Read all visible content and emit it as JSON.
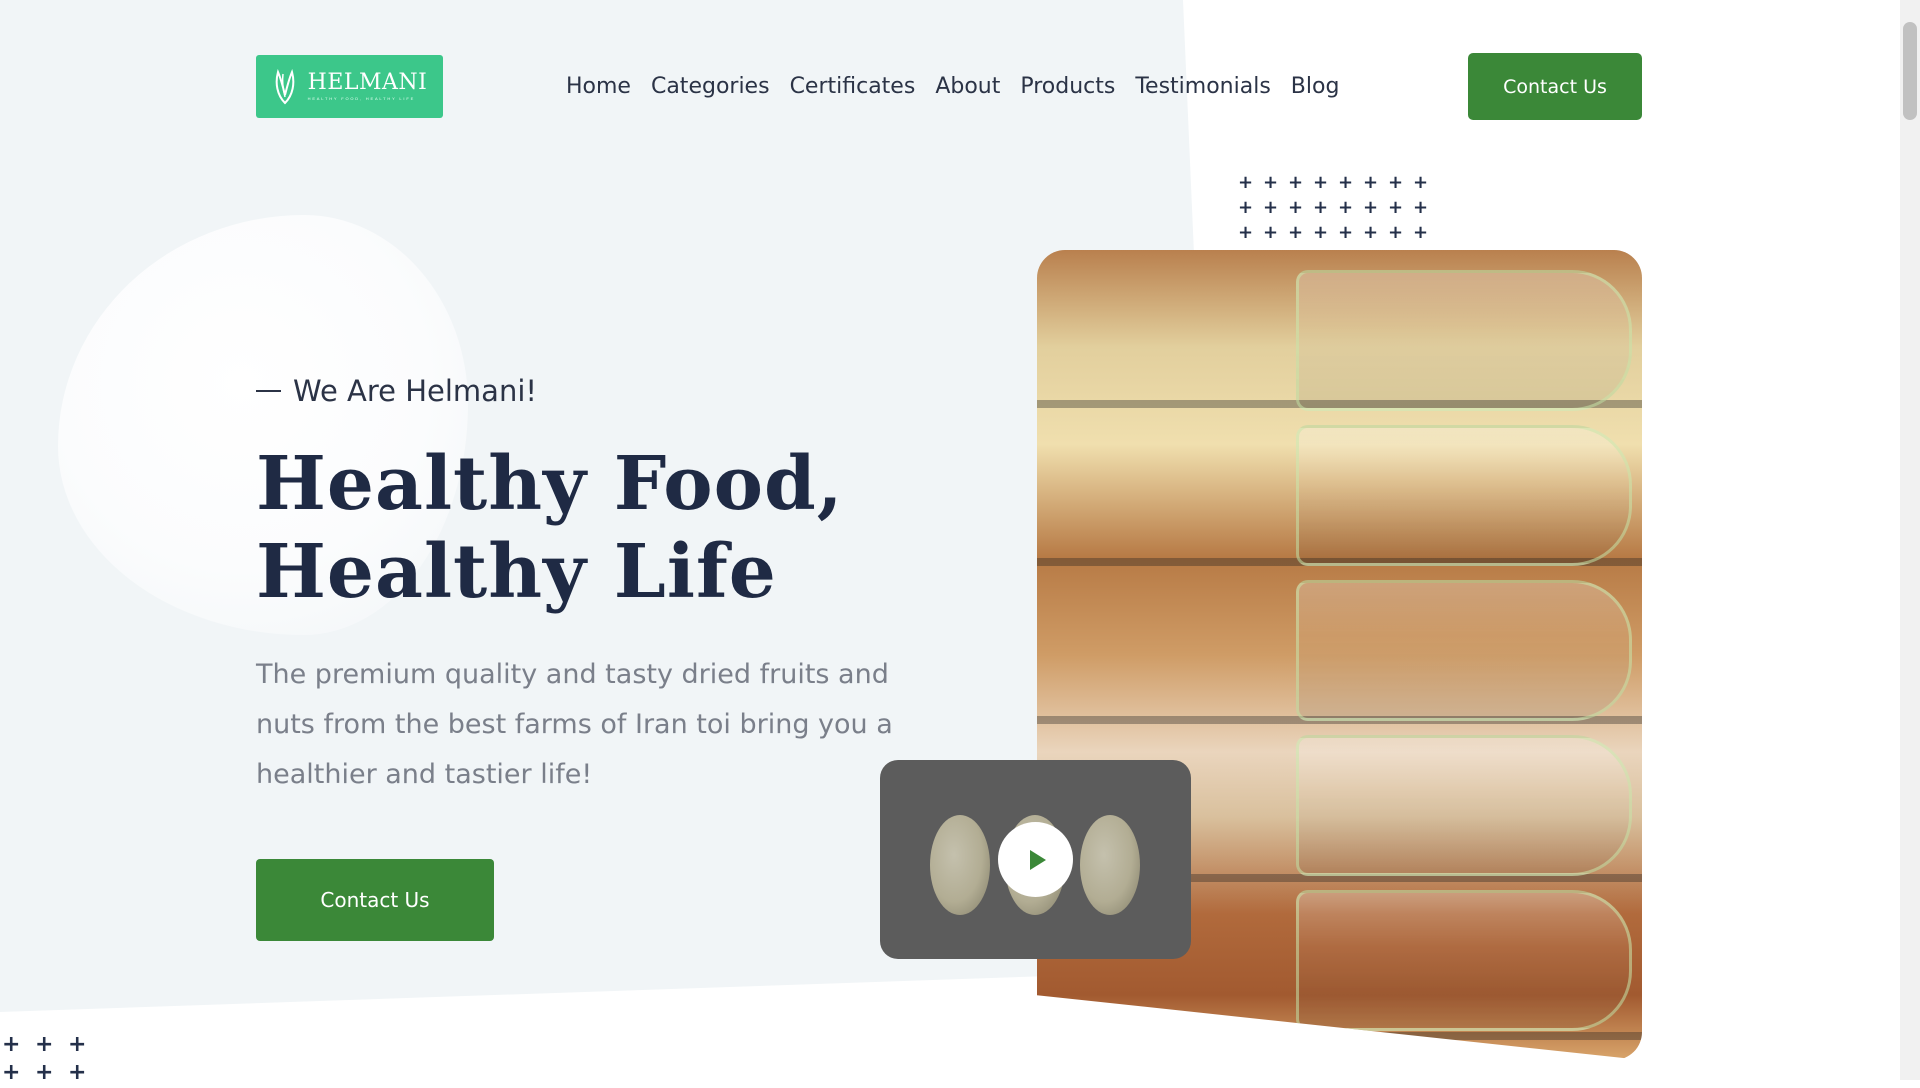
{
  "brand": {
    "logo_text": "HELMANI",
    "logo_tagline": "HEALTHY FOOD, HEALTHY LIFE",
    "accent_color": "#3cc78a",
    "button_color": "#3b8838"
  },
  "nav": {
    "items": [
      {
        "label": "Home"
      },
      {
        "label": "Categories"
      },
      {
        "label": "Certificates"
      },
      {
        "label": "About"
      },
      {
        "label": "Products"
      },
      {
        "label": "Testimonials"
      },
      {
        "label": "Blog"
      }
    ],
    "contact_label": "Contact Us"
  },
  "hero": {
    "tagline": "We Are Helmani!",
    "headline_line1": "Healthy Food,",
    "headline_line2": "Healthy Life",
    "description": "The premium quality and tasty dried fruits and nuts from the best farms of Iran toi bring you a healthier and tastier life!",
    "cta_label": "Contact Us"
  },
  "media": {
    "image_icon": "nuts-photo",
    "video_icon": "play-icon"
  }
}
